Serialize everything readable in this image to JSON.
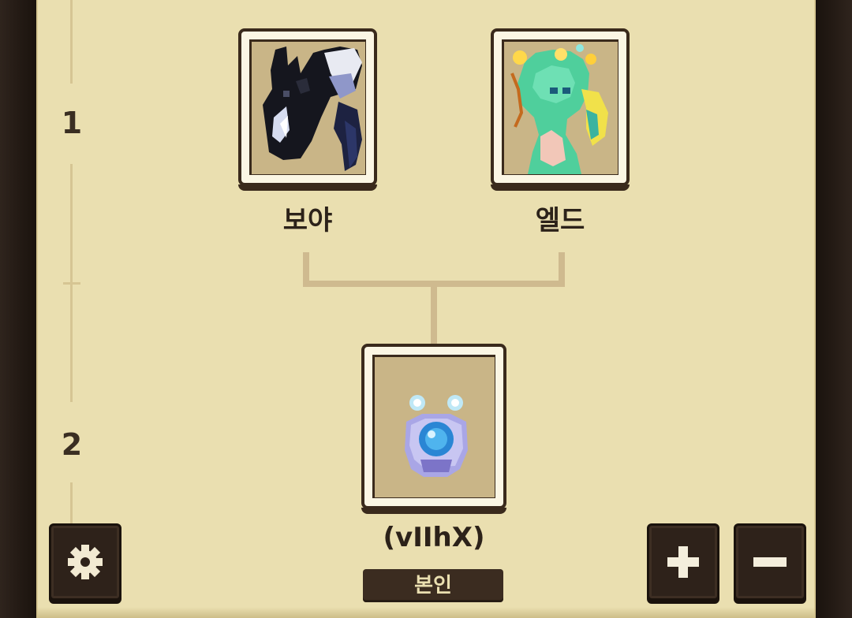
{
  "generation_labels": [
    "1",
    "2"
  ],
  "parents": [
    {
      "name": "보야",
      "portrait": "black-dragon-icon"
    },
    {
      "name": "엘드",
      "portrait": "green-dragon-icon"
    }
  ],
  "child": {
    "name": "(vIIhX)",
    "portrait": "blue-egg-icon",
    "tag": "본인"
  },
  "controls": {
    "settings": "gear-icon",
    "zoom_in": "plus-icon",
    "zoom_out": "minus-icon"
  },
  "colors": {
    "panel": "#eadfb0",
    "frame": "#2b2019",
    "card_border": "#3a2a1c",
    "connector": "#cfba8f",
    "text": "#2c2219"
  }
}
